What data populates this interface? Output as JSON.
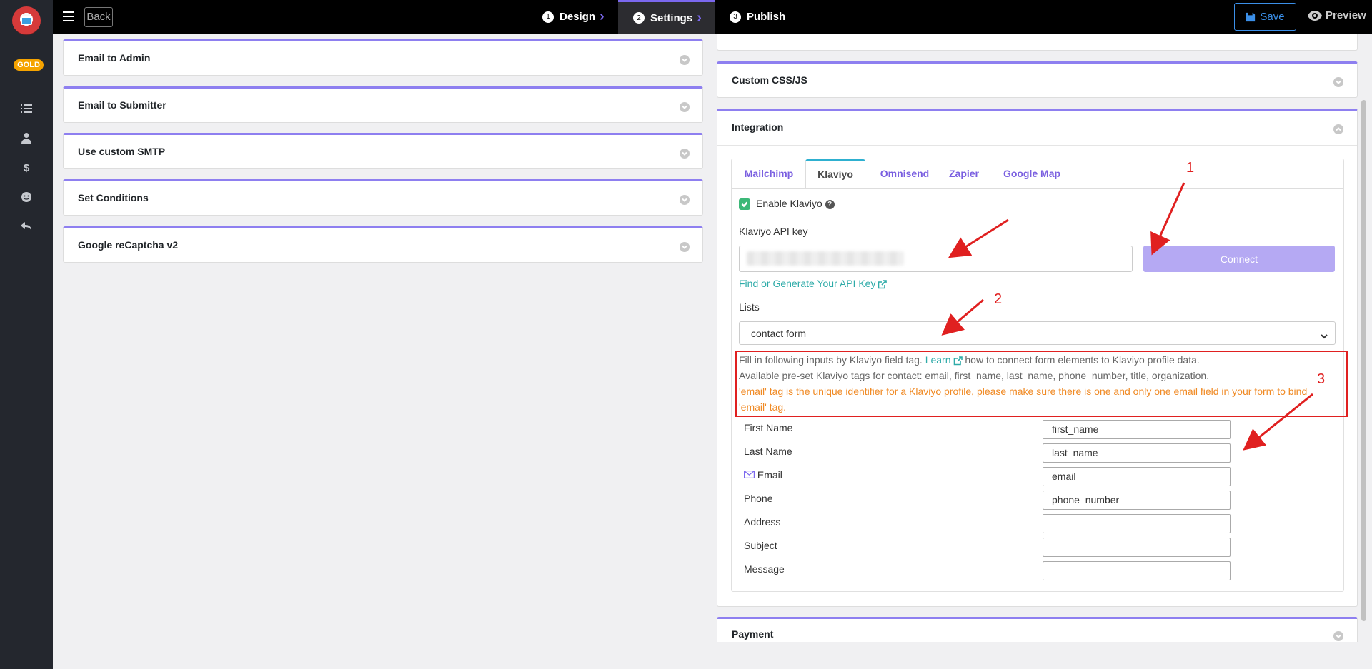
{
  "sidebar": {
    "badge": "GOLD",
    "icons": [
      "list-icon",
      "user-icon",
      "dollar-icon",
      "smile-icon",
      "reply-icon"
    ]
  },
  "topbar": {
    "back_label": "Back",
    "steps": [
      {
        "num": "1",
        "label": "Design"
      },
      {
        "num": "2",
        "label": "Settings"
      },
      {
        "num": "3",
        "label": "Publish"
      }
    ],
    "save_label": "Save",
    "preview_label": "Preview"
  },
  "left_panels": [
    {
      "title": "Email to Admin"
    },
    {
      "title": "Email to Submitter"
    },
    {
      "title": "Use custom SMTP"
    },
    {
      "title": "Set Conditions"
    },
    {
      "title": "Google reCaptcha v2"
    }
  ],
  "right_panels": {
    "custom_css": "Custom CSS/JS",
    "integration": "Integration",
    "payment": "Payment"
  },
  "integration": {
    "tabs": [
      "Mailchimp",
      "Klaviyo",
      "Omnisend",
      "Zapier",
      "Google Map"
    ],
    "active_tab": "Klaviyo",
    "enable_label": "Enable Klaviyo",
    "api_key_label": "Klaviyo API key",
    "connect_label": "Connect",
    "find_key_link": "Find or Generate Your API Key",
    "lists_label": "Lists",
    "lists_value": "contact form",
    "info_line1_pre": "Fill in following inputs by Klaviyo field tag.",
    "info_line1_link": "Learn",
    "info_line1_post": "how to connect form elements to Klaviyo profile data.",
    "info_line2": "Available pre-set Klaviyo tags for contact: email, first_name, last_name, phone_number, title, organization.",
    "info_warn_line1": "'email' tag is the unique identifier for a Klaviyo profile, please make sure there is one and only one email field in your form to bind",
    "info_warn_line2": "'email' tag.",
    "fields": [
      {
        "label": "First Name",
        "value": "first_name"
      },
      {
        "label": "Last Name",
        "value": "last_name"
      },
      {
        "label": "Email",
        "value": "email"
      },
      {
        "label": "Phone",
        "value": "phone_number"
      },
      {
        "label": "Address",
        "value": ""
      },
      {
        "label": "Subject",
        "value": ""
      },
      {
        "label": "Message",
        "value": ""
      }
    ]
  },
  "annotations": [
    "1",
    "2",
    "3"
  ],
  "colors": {
    "accent": "#8e7ff0",
    "annotation": "#e02020",
    "link": "#2eaba8",
    "warn": "#f08a24",
    "badge": "#f5a300"
  }
}
